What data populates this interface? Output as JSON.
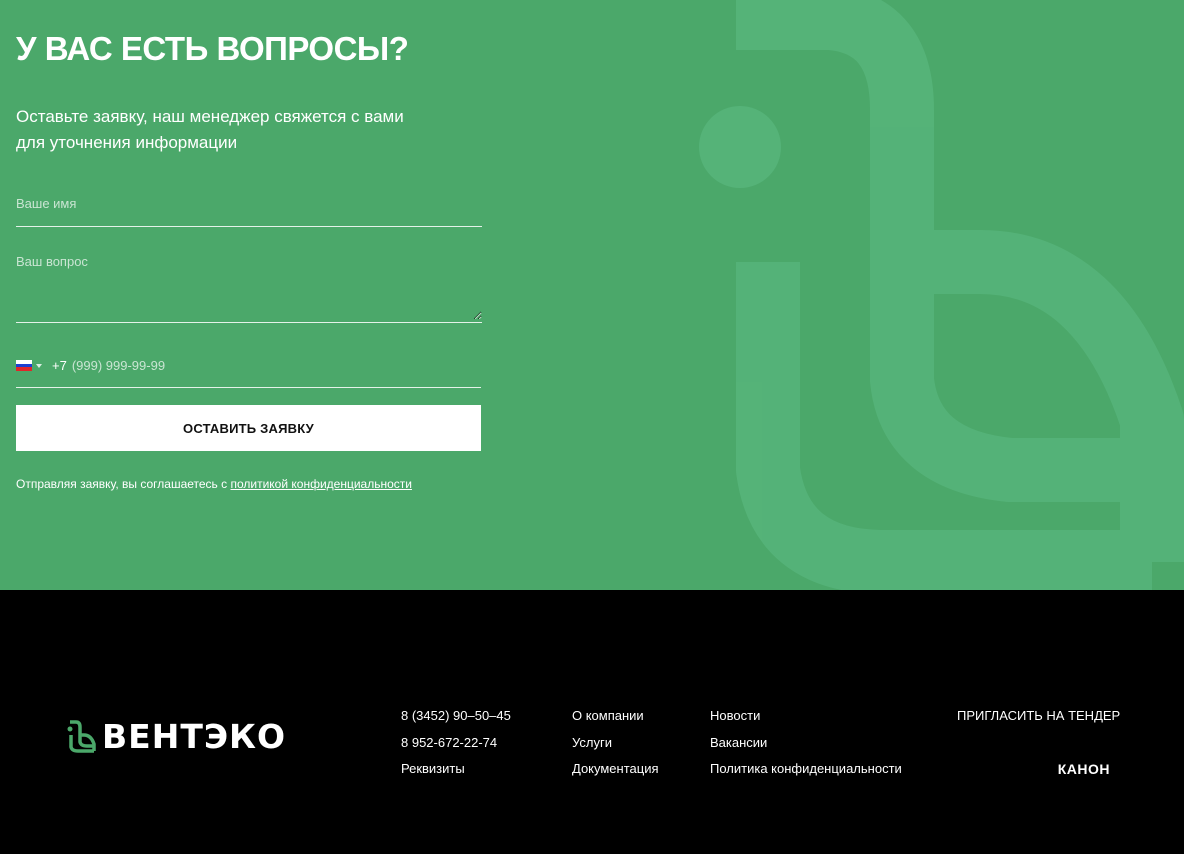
{
  "contact": {
    "title": "У ВАС ЕСТЬ ВОПРОСЫ?",
    "subtitle_line1": "Оставьте заявку, наш менеджер свяжется с вами",
    "subtitle_line2": "для уточнения информации",
    "name_placeholder": "Ваше имя",
    "question_placeholder": "Ваш вопрос",
    "phone_dial_code": "+7",
    "phone_placeholder": "(999) 999-99-99",
    "country_flag": "ru-flag-icon",
    "submit_label": "ОСТАВИТЬ ЗАЯВКУ",
    "consent_text": "Отправляя заявку, вы соглашаетесь с ",
    "consent_link": "политикой конфиденциальности",
    "background_color": "#4ba86a"
  },
  "footer": {
    "logo_text": "ВЕНТЭКО",
    "col1": [
      "8 (3452) 90–50–45",
      "8 952-672-22-74",
      "Реквизиты"
    ],
    "col2": [
      "О компании",
      "Услуги",
      "Документация"
    ],
    "col3": [
      "Новости",
      "Вакансии",
      "Политика конфиденциальности"
    ],
    "tender_link": "ПРИГЛАСИТЬ НА ТЕНДЕР",
    "developer": "КАНОН",
    "background_color": "#000000",
    "logo_color": "#4ba86a"
  }
}
